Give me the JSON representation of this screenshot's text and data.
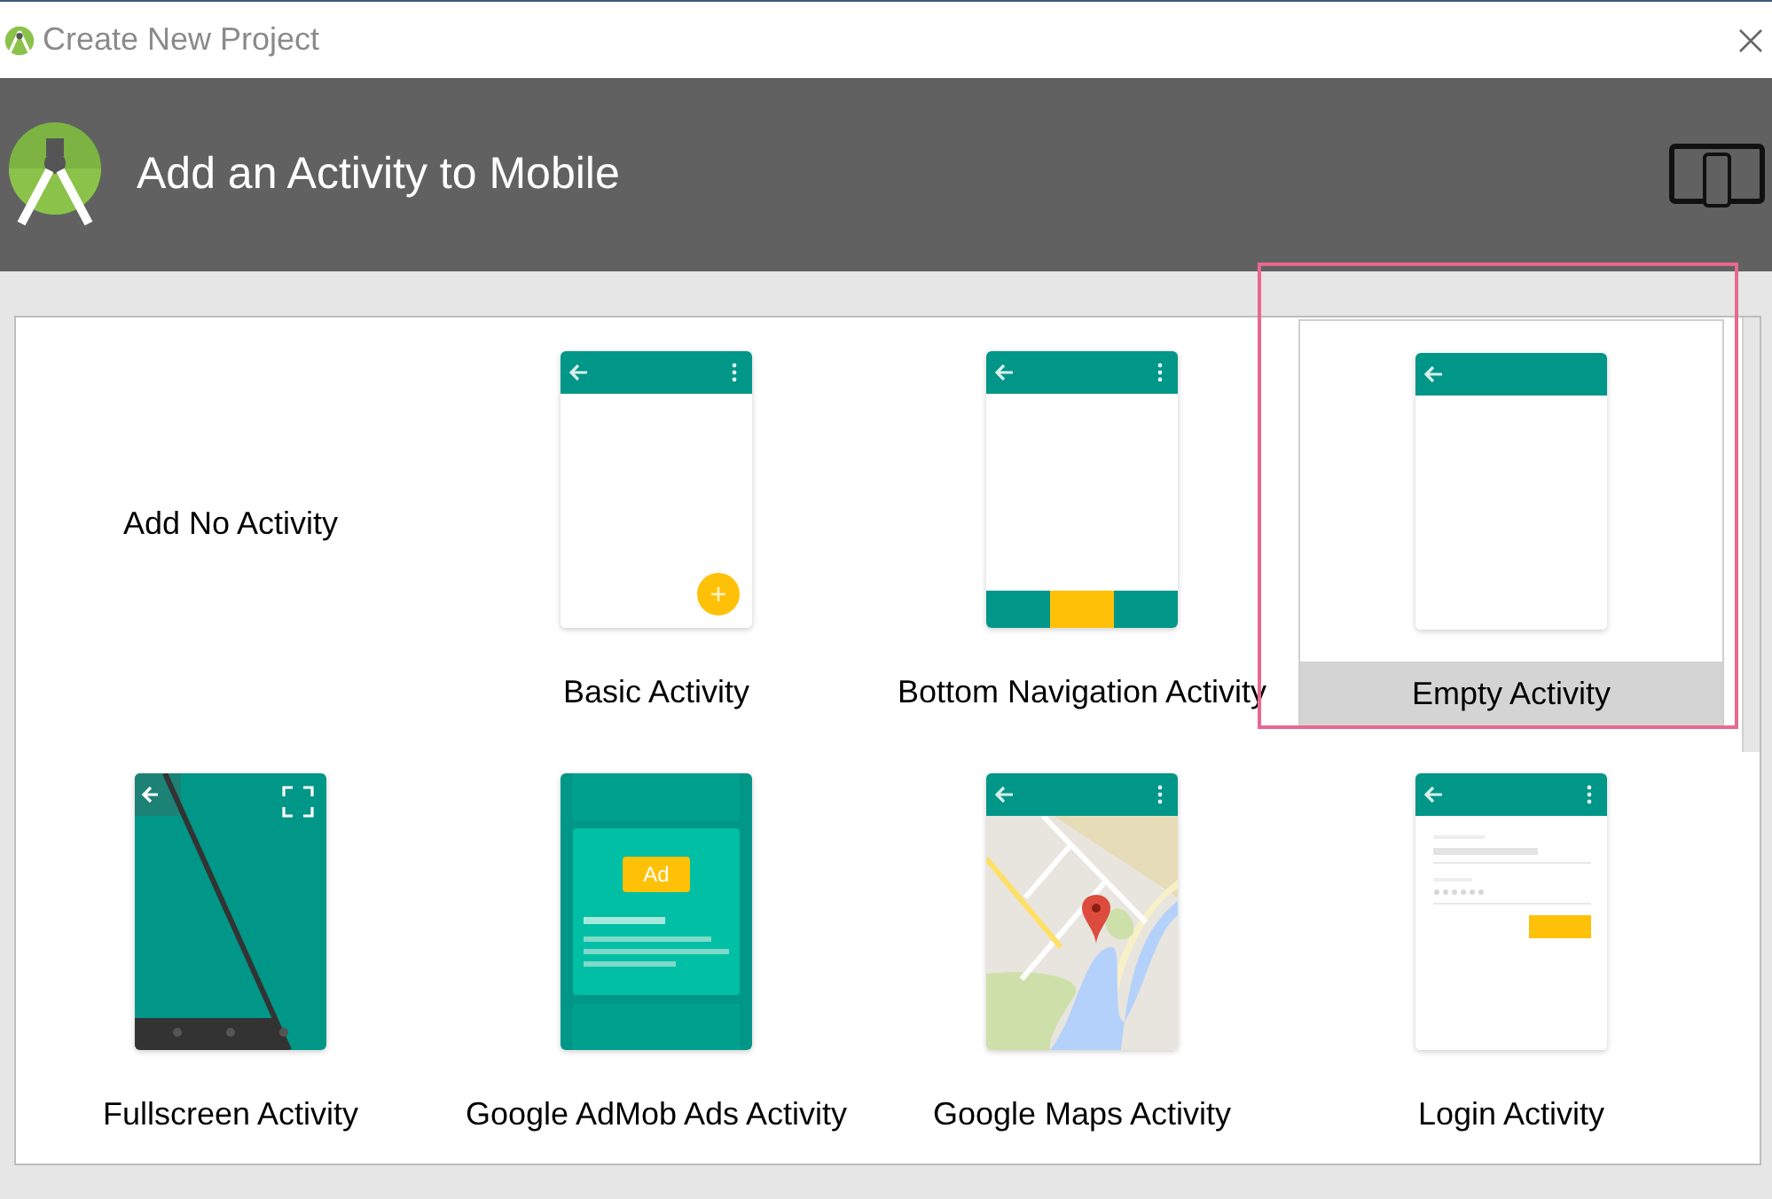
{
  "window": {
    "title": "Create New Project"
  },
  "header": {
    "title": "Add an Activity to Mobile"
  },
  "tiles": [
    {
      "kind": "none",
      "label": "Add No Activity",
      "selected": false
    },
    {
      "kind": "basic",
      "label": "Basic Activity",
      "selected": false
    },
    {
      "kind": "bottomnav",
      "label": "Bottom Navigation Activity",
      "selected": false
    },
    {
      "kind": "empty",
      "label": "Empty Activity",
      "selected": true
    },
    {
      "kind": "fullscreen",
      "label": "Fullscreen Activity",
      "selected": false
    },
    {
      "kind": "admob",
      "label": "Google AdMob Ads Activity",
      "selected": false,
      "ad_label": "Ad"
    },
    {
      "kind": "maps",
      "label": "Google Maps Activity",
      "selected": false
    },
    {
      "kind": "login",
      "label": "Login Activity",
      "selected": false
    }
  ]
}
